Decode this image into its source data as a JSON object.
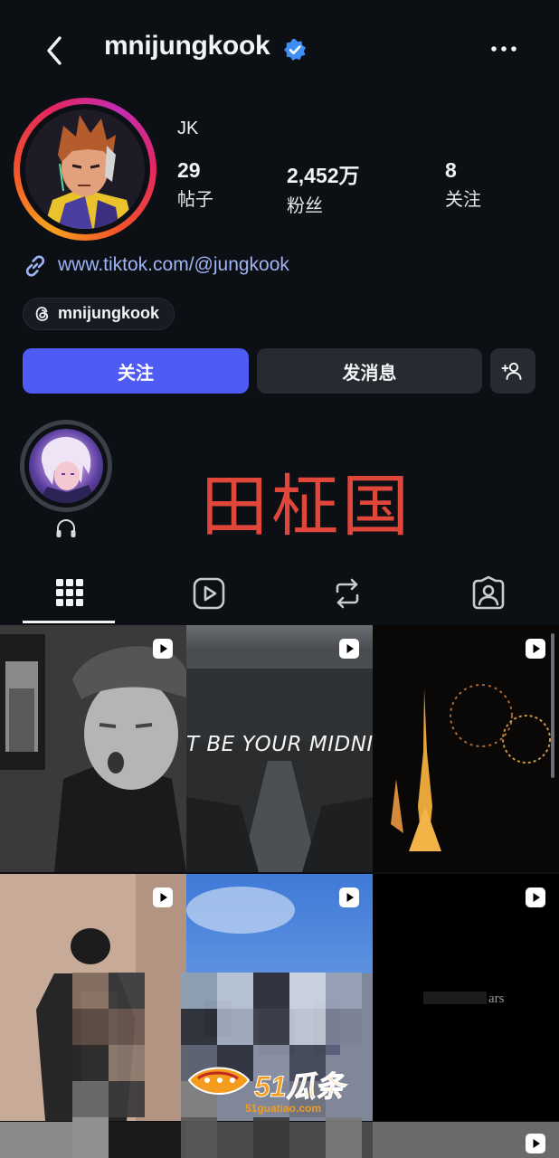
{
  "header": {
    "username": "mnijungkook",
    "back_icon": "chevron-left-icon",
    "verified_icon": "verified-badge-icon",
    "more_icon": "more-horizontal-icon"
  },
  "profile": {
    "display_name": "JK",
    "stats": [
      {
        "value": "29",
        "label": "帖子"
      },
      {
        "value": "2,452万",
        "label": "粉丝"
      },
      {
        "value": "8",
        "label": "关注"
      }
    ],
    "link": "www.tiktok.com/@jungkook",
    "threads_handle": "mnijungkook"
  },
  "actions": {
    "follow_label": "关注",
    "message_label": "发消息",
    "add_icon": "add-person-icon"
  },
  "highlight": {
    "icon": "headphones-icon"
  },
  "overlay_text": "田柾国",
  "tabs": [
    {
      "name": "grid",
      "icon": "grid-icon",
      "active": true
    },
    {
      "name": "reels",
      "icon": "reels-icon",
      "active": false
    },
    {
      "name": "reposts",
      "icon": "repost-icon",
      "active": false
    },
    {
      "name": "tagged",
      "icon": "tagged-person-icon",
      "active": false
    }
  ],
  "posts": {
    "midnight_caption": "T BE YOUR MIDNIGHT",
    "ars_caption": "ars"
  },
  "watermark": {
    "brand": "51瓜条",
    "url": "51guatiao.com"
  },
  "colors": {
    "background": "#0c0f14",
    "follow_button": "#4f5bf5",
    "secondary_button": "#262a31",
    "link": "#9fb4f5",
    "overlay_text": "#e0463a",
    "verified": "#3d8ff5"
  }
}
